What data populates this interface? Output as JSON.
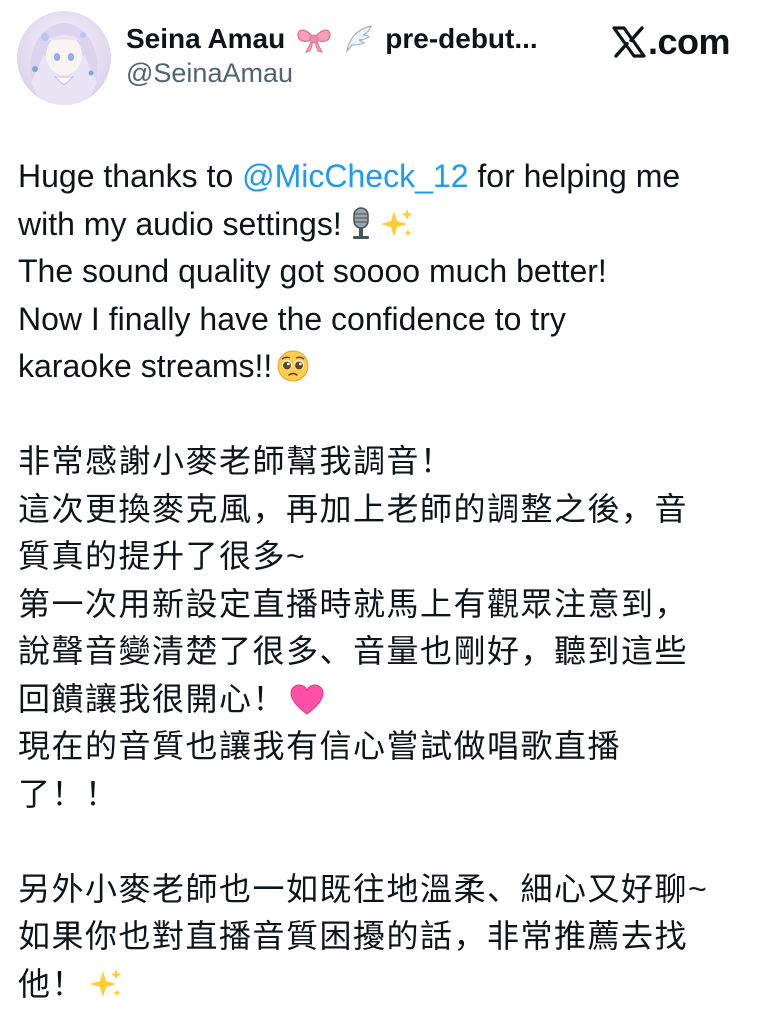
{
  "header": {
    "display_name": "Seina Amau",
    "name_suffix": "pre-debut...",
    "handle": "@SeinaAmau",
    "brand": ".com",
    "emojis": [
      "ribbon-icon",
      "wing-icon"
    ]
  },
  "tweet": {
    "en": {
      "line1_pre": "Huge thanks to ",
      "mention": "@MicCheck_12",
      "line1_post": " for helping me",
      "line2": "with my audio settings!",
      "line3": "The sound quality got soooo much better!",
      "line4": "Now I finally have the confidence to try",
      "line5": "karaoke streams!!"
    },
    "zh": {
      "line1": "非常感謝小麥老師幫我調音！",
      "line2": "這次更換麥克風，再加上老師的調整之後，音",
      "line3": "質真的提升了很多~",
      "line4": "第一次用新設定直播時就馬上有觀眾注意到，",
      "line5": "說聲音變清楚了很多、音量也剛好，聽到這些",
      "line6": "回饋讓我很開心！",
      "line7": "現在的音質也讓我有信心嘗試做唱歌直播",
      "line8": "了！！"
    },
    "zh2": {
      "line1": "另外小麥老師也一如既往地溫柔、細心又好聊~",
      "line2": "如果你也對直播音質困擾的話，非常推薦去找",
      "line3": "他！"
    },
    "icons": [
      "microphone-icon",
      "sparkles-icon",
      "pleading-face-icon",
      "pink-heart-icon"
    ]
  },
  "colors": {
    "text": "#0f1419",
    "secondary": "#536471",
    "mention": "#1d9bf0",
    "heart": "#ff4fa7",
    "sparkle": "#ffcc33"
  }
}
